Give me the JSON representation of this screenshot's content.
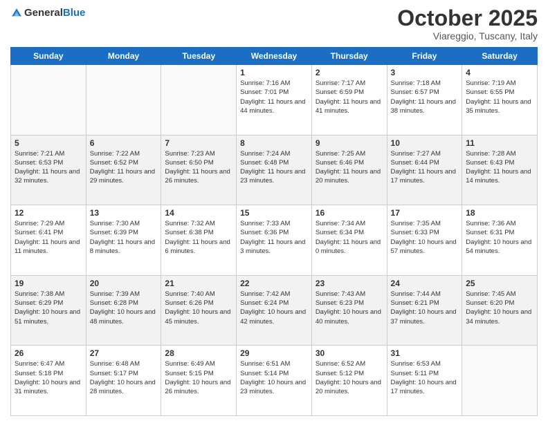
{
  "header": {
    "logo_general": "General",
    "logo_blue": "Blue",
    "title": "October 2025",
    "location": "Viareggio, Tuscany, Italy"
  },
  "days_of_week": [
    "Sunday",
    "Monday",
    "Tuesday",
    "Wednesday",
    "Thursday",
    "Friday",
    "Saturday"
  ],
  "weeks": [
    [
      {
        "day": "",
        "info": ""
      },
      {
        "day": "",
        "info": ""
      },
      {
        "day": "",
        "info": ""
      },
      {
        "day": "1",
        "info": "Sunrise: 7:16 AM\nSunset: 7:01 PM\nDaylight: 11 hours and 44 minutes."
      },
      {
        "day": "2",
        "info": "Sunrise: 7:17 AM\nSunset: 6:59 PM\nDaylight: 11 hours and 41 minutes."
      },
      {
        "day": "3",
        "info": "Sunrise: 7:18 AM\nSunset: 6:57 PM\nDaylight: 11 hours and 38 minutes."
      },
      {
        "day": "4",
        "info": "Sunrise: 7:19 AM\nSunset: 6:55 PM\nDaylight: 11 hours and 35 minutes."
      }
    ],
    [
      {
        "day": "5",
        "info": "Sunrise: 7:21 AM\nSunset: 6:53 PM\nDaylight: 11 hours and 32 minutes."
      },
      {
        "day": "6",
        "info": "Sunrise: 7:22 AM\nSunset: 6:52 PM\nDaylight: 11 hours and 29 minutes."
      },
      {
        "day": "7",
        "info": "Sunrise: 7:23 AM\nSunset: 6:50 PM\nDaylight: 11 hours and 26 minutes."
      },
      {
        "day": "8",
        "info": "Sunrise: 7:24 AM\nSunset: 6:48 PM\nDaylight: 11 hours and 23 minutes."
      },
      {
        "day": "9",
        "info": "Sunrise: 7:25 AM\nSunset: 6:46 PM\nDaylight: 11 hours and 20 minutes."
      },
      {
        "day": "10",
        "info": "Sunrise: 7:27 AM\nSunset: 6:44 PM\nDaylight: 11 hours and 17 minutes."
      },
      {
        "day": "11",
        "info": "Sunrise: 7:28 AM\nSunset: 6:43 PM\nDaylight: 11 hours and 14 minutes."
      }
    ],
    [
      {
        "day": "12",
        "info": "Sunrise: 7:29 AM\nSunset: 6:41 PM\nDaylight: 11 hours and 11 minutes."
      },
      {
        "day": "13",
        "info": "Sunrise: 7:30 AM\nSunset: 6:39 PM\nDaylight: 11 hours and 8 minutes."
      },
      {
        "day": "14",
        "info": "Sunrise: 7:32 AM\nSunset: 6:38 PM\nDaylight: 11 hours and 6 minutes."
      },
      {
        "day": "15",
        "info": "Sunrise: 7:33 AM\nSunset: 6:36 PM\nDaylight: 11 hours and 3 minutes."
      },
      {
        "day": "16",
        "info": "Sunrise: 7:34 AM\nSunset: 6:34 PM\nDaylight: 11 hours and 0 minutes."
      },
      {
        "day": "17",
        "info": "Sunrise: 7:35 AM\nSunset: 6:33 PM\nDaylight: 10 hours and 57 minutes."
      },
      {
        "day": "18",
        "info": "Sunrise: 7:36 AM\nSunset: 6:31 PM\nDaylight: 10 hours and 54 minutes."
      }
    ],
    [
      {
        "day": "19",
        "info": "Sunrise: 7:38 AM\nSunset: 6:29 PM\nDaylight: 10 hours and 51 minutes."
      },
      {
        "day": "20",
        "info": "Sunrise: 7:39 AM\nSunset: 6:28 PM\nDaylight: 10 hours and 48 minutes."
      },
      {
        "day": "21",
        "info": "Sunrise: 7:40 AM\nSunset: 6:26 PM\nDaylight: 10 hours and 45 minutes."
      },
      {
        "day": "22",
        "info": "Sunrise: 7:42 AM\nSunset: 6:24 PM\nDaylight: 10 hours and 42 minutes."
      },
      {
        "day": "23",
        "info": "Sunrise: 7:43 AM\nSunset: 6:23 PM\nDaylight: 10 hours and 40 minutes."
      },
      {
        "day": "24",
        "info": "Sunrise: 7:44 AM\nSunset: 6:21 PM\nDaylight: 10 hours and 37 minutes."
      },
      {
        "day": "25",
        "info": "Sunrise: 7:45 AM\nSunset: 6:20 PM\nDaylight: 10 hours and 34 minutes."
      }
    ],
    [
      {
        "day": "26",
        "info": "Sunrise: 6:47 AM\nSunset: 5:18 PM\nDaylight: 10 hours and 31 minutes."
      },
      {
        "day": "27",
        "info": "Sunrise: 6:48 AM\nSunset: 5:17 PM\nDaylight: 10 hours and 28 minutes."
      },
      {
        "day": "28",
        "info": "Sunrise: 6:49 AM\nSunset: 5:15 PM\nDaylight: 10 hours and 26 minutes."
      },
      {
        "day": "29",
        "info": "Sunrise: 6:51 AM\nSunset: 5:14 PM\nDaylight: 10 hours and 23 minutes."
      },
      {
        "day": "30",
        "info": "Sunrise: 6:52 AM\nSunset: 5:12 PM\nDaylight: 10 hours and 20 minutes."
      },
      {
        "day": "31",
        "info": "Sunrise: 6:53 AM\nSunset: 5:11 PM\nDaylight: 10 hours and 17 minutes."
      },
      {
        "day": "",
        "info": ""
      }
    ]
  ]
}
